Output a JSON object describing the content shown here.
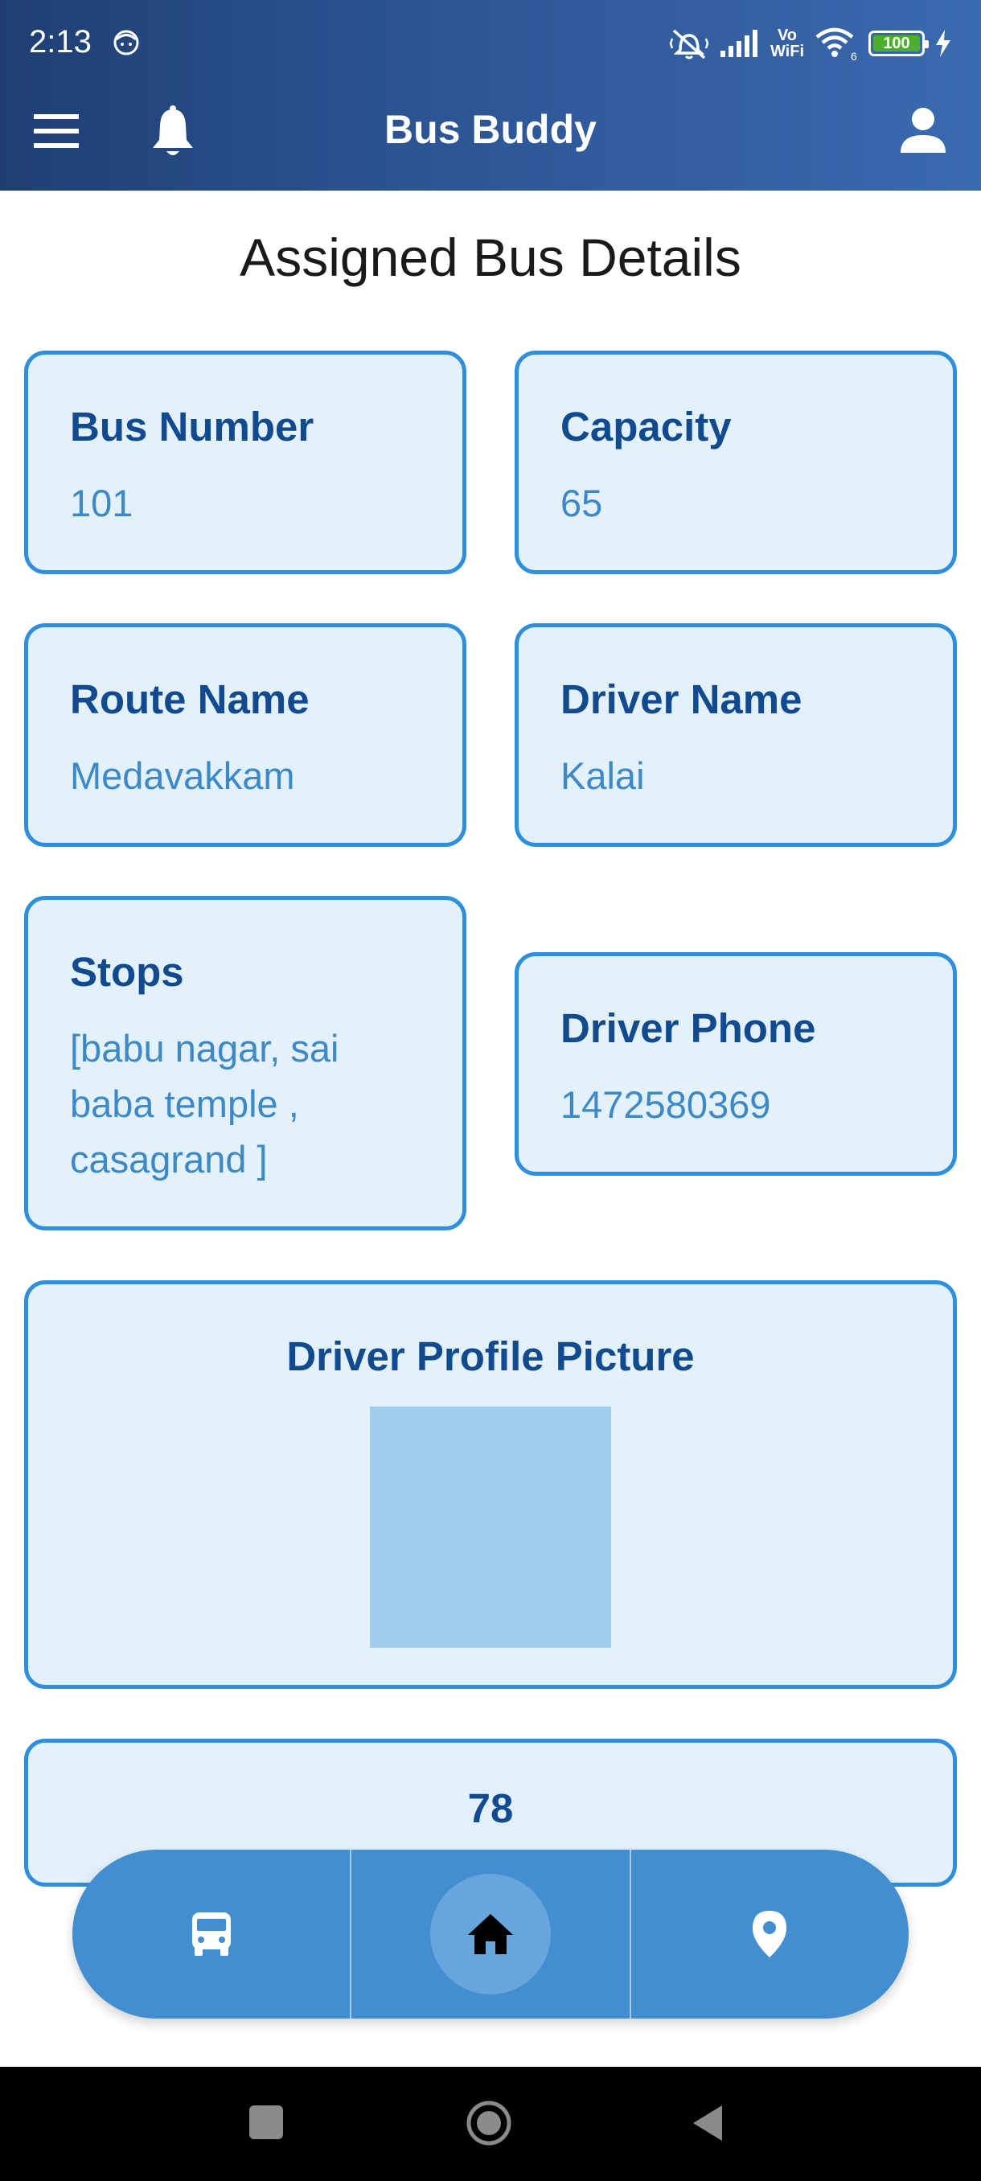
{
  "status_bar": {
    "time": "2:13",
    "vowifi_top": "Vo",
    "vowifi_bottom": "WiFi",
    "wifi_badge": "6",
    "battery": "100"
  },
  "app_bar": {
    "title": "Bus Buddy",
    "menu_icon": "hamburger-menu-icon",
    "bell_icon": "bell-icon",
    "profile_icon": "person-icon"
  },
  "page": {
    "title": "Assigned Bus Details"
  },
  "details": {
    "bus_number": {
      "label": "Bus Number",
      "value": "101"
    },
    "capacity": {
      "label": "Capacity",
      "value": "65"
    },
    "route_name": {
      "label": "Route Name",
      "value": "Medavakkam"
    },
    "driver_name": {
      "label": "Driver Name",
      "value": "Kalai"
    },
    "stops": {
      "label": "Stops",
      "value_line1": "[babu nagar, sai",
      "value_line2": "baba temple ,",
      "value_line3": "casagrand ]"
    },
    "driver_phone": {
      "label": "Driver Phone",
      "value": "1472580369"
    },
    "driver_picture": {
      "label": "Driver Profile Picture"
    },
    "extra_number": "78"
  },
  "bottom_nav": {
    "items": [
      "bus-icon",
      "home-icon",
      "location-pin-icon"
    ],
    "active": "home-icon"
  },
  "colors": {
    "header_start": "#1f3f73",
    "header_end": "#3a6aaf",
    "card_bg": "#e3f1fc",
    "card_border": "#2f8fdc",
    "label": "#124a8f",
    "value": "#3d88c7",
    "nav_bg": "#428ed0"
  }
}
